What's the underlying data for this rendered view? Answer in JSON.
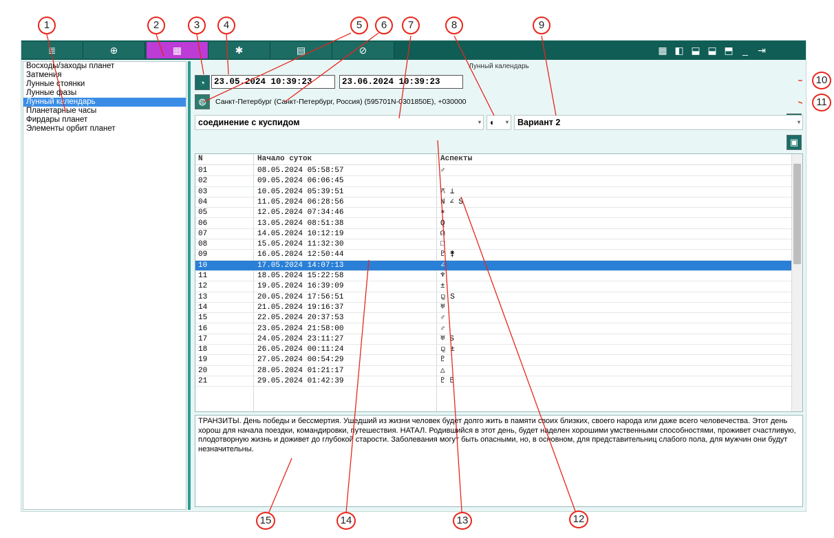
{
  "toolbar": {
    "tabs": [
      {
        "icon": "list-icon",
        "glyph": "≣"
      },
      {
        "icon": "crosshair-icon",
        "glyph": "⊕"
      },
      {
        "icon": "grid-icon",
        "glyph": "▦",
        "active": true
      },
      {
        "icon": "gear-icon",
        "glyph": "✱"
      },
      {
        "icon": "document-icon",
        "glyph": "▤"
      },
      {
        "icon": "orbit-icon",
        "glyph": "⊘"
      }
    ],
    "window_buttons": [
      {
        "icon": "tiles-icon",
        "glyph": "▦"
      },
      {
        "icon": "layout-left-icon",
        "glyph": "◧"
      },
      {
        "icon": "layout-bottom-icon",
        "glyph": "⬓"
      },
      {
        "icon": "layout-bottom2-icon",
        "glyph": "⬓"
      },
      {
        "icon": "layout-top-icon",
        "glyph": "⬒"
      },
      {
        "icon": "minimize-icon",
        "glyph": "_"
      },
      {
        "icon": "exit-icon",
        "glyph": "⇥"
      }
    ],
    "active_color": "#bd3bd6"
  },
  "sidebar": {
    "items": [
      "Восходы/заходы планет",
      "Затмения",
      "Лунные стоянки",
      "Лунные фазы",
      "Лунный календарь",
      "Планетарные часы",
      "Фирдары планет",
      "Элементы орбит планет"
    ],
    "selected_index": 4
  },
  "panel": {
    "title": "Лунный календарь",
    "date_from": "23.05.2024 10:39:23",
    "date_to": "23.06.2024 10:39:23",
    "location": "Санкт-Петербург (Санкт-Петербург, Россия) (595701N-0301850E), +030000",
    "aspect_combo": "соединение с куспидом",
    "variant_combo": "Вариант 2"
  },
  "table": {
    "columns": [
      "N",
      "Начало суток",
      "Аспекты"
    ],
    "selected_row": 9,
    "rows": [
      [
        "01",
        "08.05.2024 05:58:57",
        "♂"
      ],
      [
        "02",
        "09.05.2024 06:06:45",
        ""
      ],
      [
        "03",
        "10.05.2024 05:39:51",
        "⚻ ⊥"
      ],
      [
        "04",
        "11.05.2024 06:28:56",
        "N ∠ S"
      ],
      [
        "05",
        "12.05.2024 07:34:46",
        "✶"
      ],
      [
        "06",
        "13.05.2024 08:51:38",
        "Q"
      ],
      [
        "07",
        "14.05.2024 10:12:19",
        "☊"
      ],
      [
        "08",
        "15.05.2024 11:32:30",
        "□"
      ],
      [
        "09",
        "16.05.2024 12:50:44",
        "♇ ⚵"
      ],
      [
        "10",
        "17.05.2024 14:07:13",
        "∠"
      ],
      [
        "11",
        "18.05.2024 15:22:58",
        "♆"
      ],
      [
        "12",
        "19.05.2024 16:39:09",
        "±"
      ],
      [
        "13",
        "20.05.2024 17:56:51",
        "⚼ S"
      ],
      [
        "14",
        "21.05.2024 19:16:37",
        "♅"
      ],
      [
        "15",
        "22.05.2024 20:37:53",
        "♂"
      ],
      [
        "16",
        "23.05.2024 21:58:00",
        "♂"
      ],
      [
        "17",
        "24.05.2024 23:11:27",
        "♅ S"
      ],
      [
        "18",
        "26.05.2024 00:11:24",
        "⚼ ±"
      ],
      [
        "19",
        "27.05.2024 00:54:29",
        "♇"
      ],
      [
        "20",
        "28.05.2024 01:21:17",
        "△"
      ],
      [
        "21",
        "29.05.2024 01:42:39",
        "♇ ♇"
      ]
    ]
  },
  "description": "ТРАНЗИТЫ. День победы и бессмертия. Ушедший из жизни человек будет долго жить в памяти своих близких, своего народа или даже всего человечества. Этот день хорош для начала поездки, командировки, путешествия. НАТАЛ. Родившийся в этот день, будет наделен хорошими умственными способностями, проживет счастливую, плодотворную жизнь и доживет до глубокой старости. Заболевания могут быть опасными, но, в основном, для представительниц слабого пола, для мужчин они будут незначительны.",
  "callouts": [
    "1",
    "2",
    "3",
    "4",
    "5",
    "6",
    "7",
    "8",
    "9",
    "10",
    "11",
    "12",
    "13",
    "14",
    "15"
  ],
  "colors": {
    "accent_teal": "#0f5d55",
    "selection_blue": "#2a7fd6",
    "callout_red": "#e8261c"
  }
}
